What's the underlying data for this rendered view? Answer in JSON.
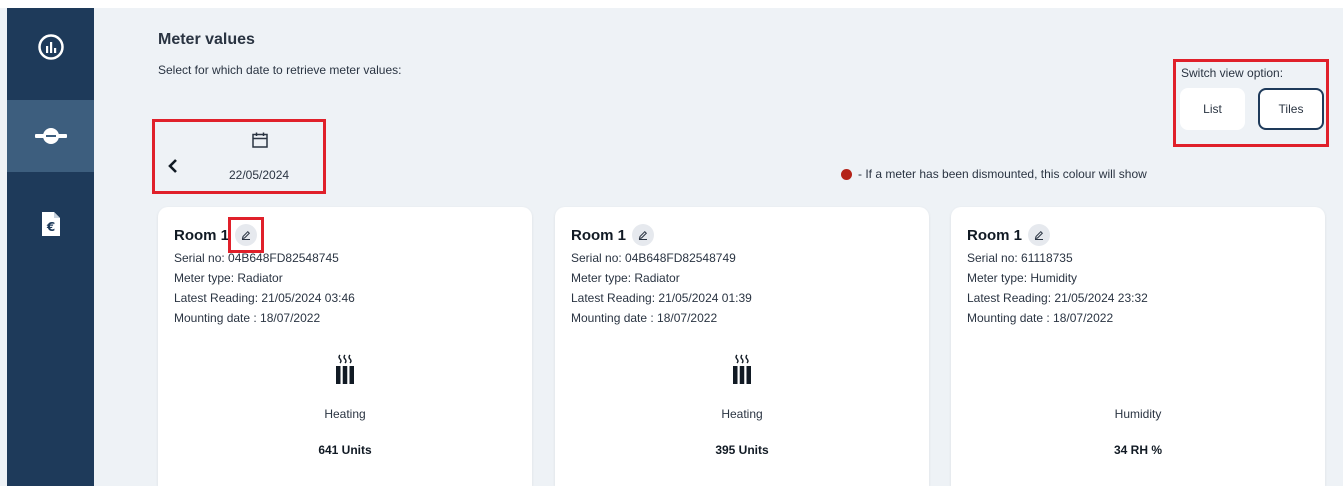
{
  "page": {
    "title": "Meter values",
    "subtitle": "Select for which date to retrieve meter values:"
  },
  "sidebar": {
    "items": [
      {
        "icon": "chart-circle-icon"
      },
      {
        "icon": "meter-pipe-icon",
        "active": true
      },
      {
        "icon": "euro-document-icon"
      }
    ]
  },
  "date_picker": {
    "date": "22/05/2024"
  },
  "legend": {
    "text": "- If a meter has been dismounted, this colour will show",
    "color": "#b42318"
  },
  "view_switch": {
    "label": "Switch view option:",
    "list_label": "List",
    "tiles_label": "Tiles",
    "selected": "Tiles"
  },
  "cards": [
    {
      "room": "Room 1",
      "serial": "Serial no: 04B648FD82548745",
      "type": "Meter type: Radiator",
      "reading": "Latest Reading: 21/05/2024 03:46",
      "mounting": "Mounting date : 18/07/2022",
      "kind": "Heating",
      "value": "641 Units"
    },
    {
      "room": "Room 1",
      "serial": "Serial no: 04B648FD82548749",
      "type": "Meter type: Radiator",
      "reading": "Latest Reading: 21/05/2024 01:39",
      "mounting": "Mounting date : 18/07/2022",
      "kind": "Heating",
      "value": "395 Units"
    },
    {
      "room": "Room 1",
      "serial": "Serial no: 61118735",
      "type": "Meter type: Humidity",
      "reading": "Latest Reading: 21/05/2024 23:32",
      "mounting": "Mounting date : 18/07/2022",
      "kind": "Humidity",
      "value": "34 RH %"
    }
  ],
  "colors": {
    "sidebar": "#1e3a5a",
    "sidebar_active": "#3d5e7e",
    "background": "#eef2f6",
    "highlight": "#e0202a"
  }
}
